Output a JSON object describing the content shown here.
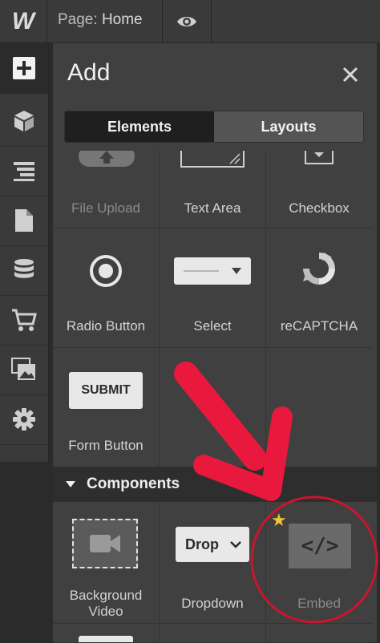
{
  "topbar": {
    "logo": "W",
    "page_key": "Page:",
    "page_value": "Home"
  },
  "panel": {
    "title": "Add",
    "tabs": [
      {
        "label": "Elements",
        "active": true
      },
      {
        "label": "Layouts",
        "active": false
      }
    ],
    "elements": [
      {
        "label": "File Upload",
        "icon": "upload-icon",
        "dim": true
      },
      {
        "label": "Text Area",
        "icon": "textarea-icon"
      },
      {
        "label": "Checkbox",
        "icon": "checkbox-icon"
      },
      {
        "label": "Radio Button",
        "icon": "radio-icon"
      },
      {
        "label": "Select",
        "icon": "select-icon"
      },
      {
        "label": "reCAPTCHA",
        "icon": "recaptcha-icon"
      },
      {
        "label": "Form Button",
        "icon": "submit-button-icon",
        "icon_text": "SUBMIT"
      }
    ],
    "section": "Components",
    "components": [
      {
        "label_line1": "Background",
        "label_line2": "Video",
        "icon": "video-icon"
      },
      {
        "label": "Dropdown",
        "icon": "dropdown-icon",
        "icon_text": "Drop"
      },
      {
        "label": "Embed",
        "icon": "embed-icon",
        "icon_text": "</>",
        "dim": true
      }
    ]
  },
  "colors": {
    "accent_red": "#e8193c",
    "star": "#f1c232"
  }
}
